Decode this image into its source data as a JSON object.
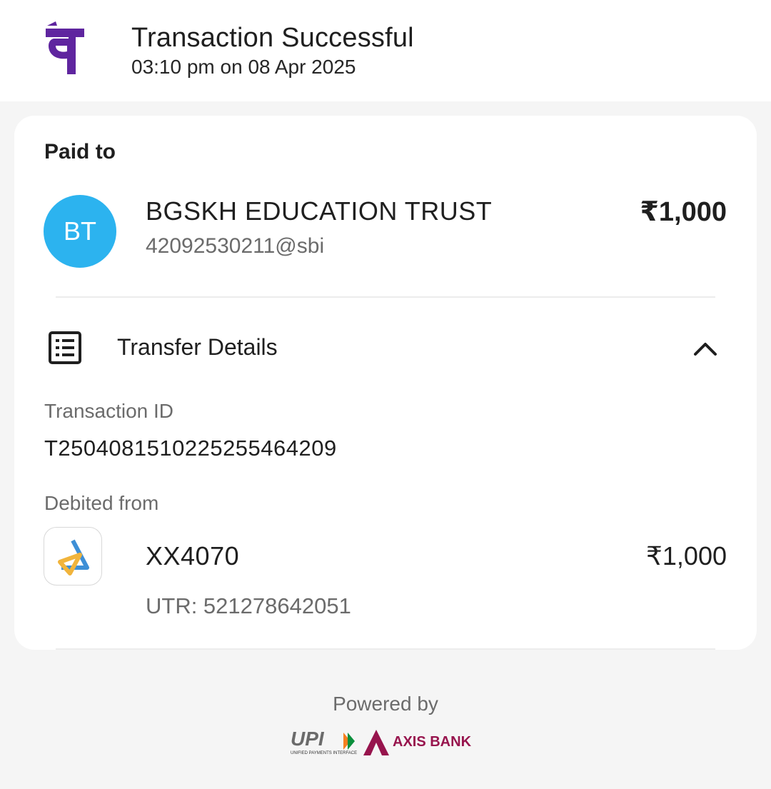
{
  "header": {
    "title": "Transaction Successful",
    "timestamp": "03:10 pm on 08 Apr 2025",
    "logo_icon": "phonepe-logo-icon",
    "logo_color": "#5f259f"
  },
  "paid_to": {
    "heading": "Paid to",
    "avatar_initials": "BT",
    "avatar_color": "#2cb3ef",
    "name": "BGSKH EDUCATION TRUST",
    "upi_id": "42092530211@sbi",
    "amount": "₹1,000"
  },
  "transfer_details": {
    "label": "Transfer Details",
    "icon": "receipt-list-icon",
    "toggle_icon": "chevron-up-icon",
    "transaction_id_label": "Transaction ID",
    "transaction_id": "T2504081510225255464209",
    "debited_from_label": "Debited from",
    "bank_icon": "bank-logo-icon",
    "account": "XX4070",
    "amount": "₹1,000",
    "utr": "UTR: 521278642051"
  },
  "footer": {
    "powered_by": "Powered by",
    "upi_logo_text": "UPI",
    "upi_tagline": "UNIFIED PAYMENTS INTERFACE",
    "bank_name": "AXIS BANK",
    "bank_color": "#97144d"
  }
}
